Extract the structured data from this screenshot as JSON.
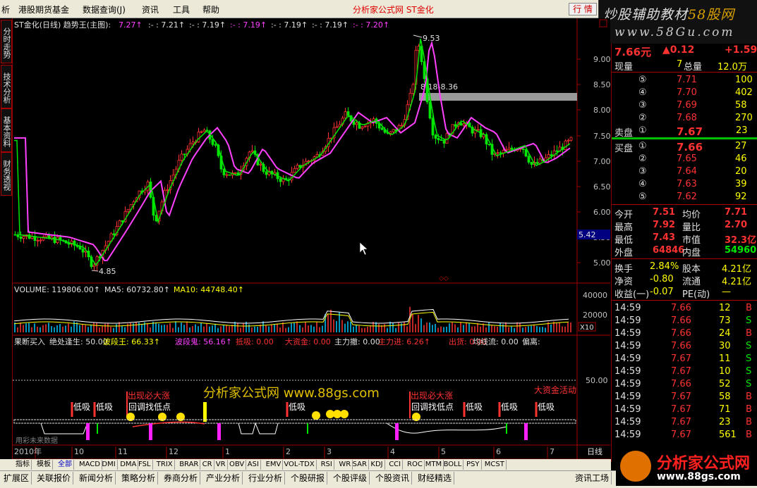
{
  "menu": {
    "items": [
      "析",
      "港股期货基金",
      "数据查询(J)",
      "资讯",
      "工具",
      "帮助"
    ],
    "title": "分析家公式网  ST金化",
    "quote_btn": "行 情"
  },
  "banner": {
    "line1a": "炒股辅助教材",
    "line1b": "58股网",
    "line2": "www.58Gu.com"
  },
  "side_tabs": [
    "分时走势",
    "技术分析",
    "基本资料",
    "财务透视"
  ],
  "price_header": {
    "label": "ST金化(日线) 趋势王(主图):",
    "values": [
      "7.27↑",
      ":- : 7.21↑",
      ":- : 7.19↑",
      ":- : 7.19↑",
      ":- : 7.19↑",
      ":- : 7.19↑",
      ":- : 7.20↑"
    ]
  },
  "price_axis": [
    "9.00",
    "8.50",
    "8.00",
    "7.50",
    "7.00",
    "6.50",
    "6.00",
    "5.50",
    "5.00"
  ],
  "annotations": {
    "high": "9.53",
    "low": "4.85",
    "range": "8.18-8.36",
    "marker": "5.42"
  },
  "volume_header": {
    "vol": "VOLUME: 119806.00↑",
    "ma5": "MA5: 60732.80↑",
    "ma10": "MA10: 44748.40↑"
  },
  "volume_axis": [
    "40000",
    "20000"
  ],
  "volume_unit": "X10",
  "indicator_header": [
    {
      "t": "果断买入",
      "c": "#e0e0e0"
    },
    {
      "t": "绝处逢生: 50.00",
      "c": "#e0e0e0"
    },
    {
      "t": "波段王: 66.33↑",
      "c": "#ffff00"
    },
    {
      "t": "波段鬼: 56.16↑",
      "c": "#ff40ff"
    },
    {
      "t": "抵吸: 0.00",
      "c": "#ff3232"
    },
    {
      "t": "大资金: 0.00",
      "c": "#ff3232"
    },
    {
      "t": "主力撤: 0.00",
      "c": "#e0e0e0"
    },
    {
      "t": "主力进: 6.26↑",
      "c": "#ff3232"
    },
    {
      "t": "出货: 0.00",
      "c": "#ff3232"
    },
    {
      "t": "均线流: 0.00",
      "c": "#e0e0e0"
    },
    {
      "t": "偏离:",
      "c": "#e0e0e0"
    }
  ],
  "indicator_axis": "50.00",
  "indicator_labels": {
    "dixi": "低吸",
    "chuxian": "出现必大涨",
    "huitiao": "回调找低点",
    "dazijin": "大资金活动",
    "watermark": "分析家公式网 www.88gs.com",
    "note": "用彩未来数据"
  },
  "time_axis": [
    "2010年",
    "10",
    "11",
    "12",
    "1",
    "2",
    "3",
    "4",
    "5",
    "6",
    "7"
  ],
  "period": "日线",
  "quote": {
    "price": "7.66元",
    "change": "▲0.12",
    "change_pct": "+1.59",
    "now_label": "现量",
    "now_val": "7",
    "total_label": "总量",
    "total_val": "12.0万",
    "sell_label": "卖盘",
    "buy_label": "买盘",
    "asks": [
      {
        "n": "⑤",
        "p": "7.71",
        "v": "100"
      },
      {
        "n": "④",
        "p": "7.70",
        "v": "402"
      },
      {
        "n": "③",
        "p": "7.69",
        "v": "58"
      },
      {
        "n": "②",
        "p": "7.68",
        "v": "270"
      },
      {
        "n": "①",
        "p": "7.67",
        "v": "23"
      }
    ],
    "bids": [
      {
        "n": "①",
        "p": "7.66",
        "v": "27"
      },
      {
        "n": "②",
        "p": "7.65",
        "v": "46"
      },
      {
        "n": "③",
        "p": "7.64",
        "v": "20"
      },
      {
        "n": "④",
        "p": "7.63",
        "v": "39"
      },
      {
        "n": "⑤",
        "p": "7.62",
        "v": "92"
      }
    ],
    "stats": [
      {
        "a": "今开",
        "b": "7.51",
        "c": "均价",
        "d": "7.71"
      },
      {
        "a": "最高",
        "b": "7.92",
        "c": "量比",
        "d": "2.70"
      },
      {
        "a": "最低",
        "b": "7.43",
        "c": "市值",
        "d": "32.3亿"
      },
      {
        "a": "外盘",
        "b": "64846",
        "c": "内盘",
        "d": "54960"
      }
    ],
    "fin": [
      {
        "a": "换手",
        "b": "2.84%",
        "c": "股本",
        "d": "4.21亿"
      },
      {
        "a": "净资",
        "b": "-0.80",
        "c": "流通",
        "d": "4.21亿"
      },
      {
        "a": "收益(一)",
        "b": "-0.07",
        "c": "PE(动)",
        "d": "—"
      }
    ],
    "ticks": [
      {
        "t": "14:59",
        "p": "7.66",
        "v": "12",
        "s": "B"
      },
      {
        "t": "14:59",
        "p": "7.66",
        "v": "73",
        "s": "S"
      },
      {
        "t": "14:59",
        "p": "7.66",
        "v": "24",
        "s": "B"
      },
      {
        "t": "14:59",
        "p": "7.66",
        "v": "30",
        "s": "S"
      },
      {
        "t": "14:59",
        "p": "7.67",
        "v": "11",
        "s": "S"
      },
      {
        "t": "14:59",
        "p": "7.67",
        "v": "10",
        "s": "S"
      },
      {
        "t": "14:59",
        "p": "7.66",
        "v": "52",
        "s": "S"
      },
      {
        "t": "14:59",
        "p": "7.67",
        "v": "58",
        "s": "B"
      },
      {
        "t": "14:59",
        "p": "7.67",
        "v": "71",
        "s": "B"
      },
      {
        "t": "14:59",
        "p": "7.67",
        "v": "23",
        "s": "B"
      },
      {
        "t": "14:59",
        "p": "7.67",
        "v": "561",
        "s": "B"
      }
    ]
  },
  "bottom_tabs1": [
    "指标",
    "模板",
    "全部",
    "MACD",
    "DMI",
    "DMA",
    "FSL",
    "TRIX",
    "BRAR",
    "CR",
    "VR",
    "OBV",
    "ASI",
    "EMV",
    "VOL-TDX",
    "RSI",
    "WR",
    "SAR",
    "KDJ",
    "CCI",
    "ROC",
    "MTM",
    "BOLL",
    "PSY",
    "MCST"
  ],
  "bottom_tabs2": [
    "扩展区",
    "关联报价",
    "新闻分析",
    "策略分析",
    "券商分析",
    "产业分析",
    "行业分析",
    "个股研报",
    "个股评级",
    "个股资讯",
    "财经精选",
    "资讯工场"
  ],
  "logo": {
    "title": "分析家公式网",
    "url": "www.88gs.com"
  },
  "colors": {
    "up": "#ff3232",
    "down": "#00e600",
    "ma": "#ff40ff",
    "accent": "#ffff00"
  }
}
